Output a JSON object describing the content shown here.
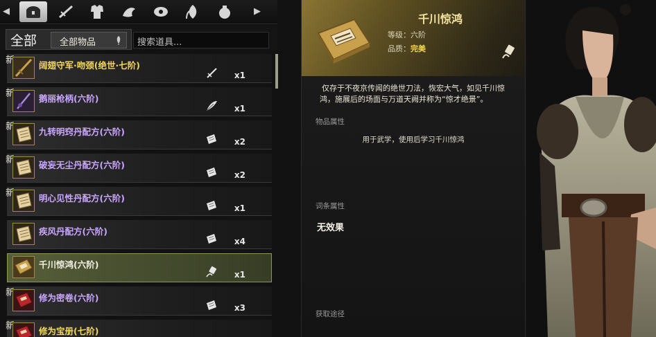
{
  "categories": {
    "items": [
      {
        "icon": "chest-icon",
        "active": true
      },
      {
        "icon": "weapon-icon",
        "active": false
      },
      {
        "icon": "armor-icon",
        "active": false
      },
      {
        "icon": "dragon-icon",
        "active": false
      },
      {
        "icon": "eye-icon",
        "active": false
      },
      {
        "icon": "herb-icon",
        "active": false
      },
      {
        "icon": "pouch-icon",
        "active": false
      }
    ]
  },
  "filter": {
    "tab_label": "全部",
    "dropdown_label": "全部物品",
    "search_placeholder": "搜索道具..."
  },
  "items": [
    {
      "name": "阔翅守军·吻颈(绝世·七阶)",
      "qty": "x1",
      "new": true,
      "new_label": "新",
      "color": "#f2d65a",
      "type_icon": "sword-icon",
      "thumb": "weapon"
    },
    {
      "name": "鹅丽枪柄(六阶)",
      "qty": "x1",
      "new": true,
      "new_label": "新",
      "color": "#c9a6ff",
      "type_icon": "feather-icon",
      "thumb": "spear"
    },
    {
      "name": "九转明窍丹配方(六阶)",
      "qty": "x2",
      "new": true,
      "new_label": "新",
      "color": "#c9a6ff",
      "type_icon": "scroll-icon",
      "thumb": "paper"
    },
    {
      "name": "破妄无尘丹配方(六阶)",
      "qty": "x2",
      "new": true,
      "new_label": "新",
      "color": "#c9a6ff",
      "type_icon": "scroll-icon",
      "thumb": "paper"
    },
    {
      "name": "明心见性丹配方(六阶)",
      "qty": "x1",
      "new": true,
      "new_label": "新",
      "color": "#c9a6ff",
      "type_icon": "scroll-icon",
      "thumb": "paper"
    },
    {
      "name": "疾风丹配方(六阶)",
      "qty": "x4",
      "new": false,
      "new_label": "",
      "color": "#c9a6ff",
      "type_icon": "scroll-icon",
      "thumb": "paper"
    },
    {
      "name": "千川惊鸿(六阶)",
      "qty": "x1",
      "new": false,
      "new_label": "",
      "color": "#f4f0e4",
      "type_icon": "scroll-tag-icon",
      "thumb": "book",
      "selected": true
    },
    {
      "name": "修为密卷(六阶)",
      "qty": "x3",
      "new": true,
      "new_label": "新",
      "color": "#c9a6ff",
      "type_icon": "scroll-icon",
      "thumb": "redbook"
    },
    {
      "name": "修为宝册(七阶)",
      "qty": "",
      "new": true,
      "new_label": "新",
      "color": "#f2d65a",
      "type_icon": "",
      "thumb": "redbook"
    }
  ],
  "detail": {
    "title": "千川惊鸿",
    "grade_label": "等级：六阶",
    "quality_prefix": "品质：",
    "quality_value": "完美",
    "description": "仅存于不夜京传闻的绝世刀法，恢宏大气，如见千川惊鸿，施展后的场面与万道天阙并称为“惊才绝景”。",
    "item_attr_label": "物品属性",
    "item_attr_text": "用于武学，使用后学习千川惊鸿",
    "entry_attr_label": "词条属性",
    "entry_attr_value": "无效果",
    "source_label": "获取途径"
  }
}
